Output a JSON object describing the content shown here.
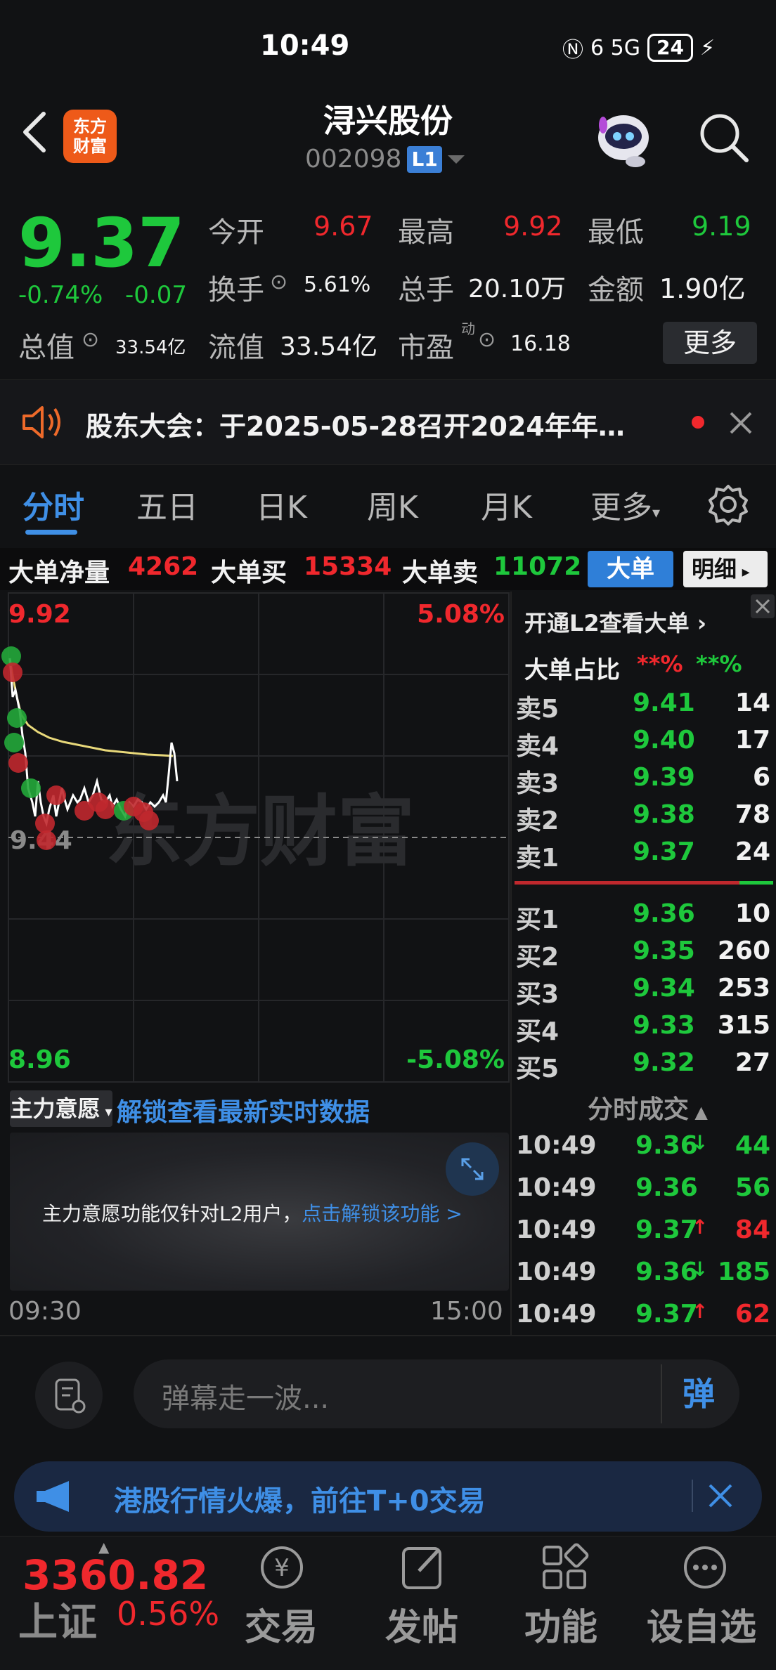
{
  "status_bar": {
    "time": "10:49",
    "signal": "6 5G",
    "battery": "24"
  },
  "header": {
    "stock_name": "浔兴股份",
    "stock_code": "002098",
    "level_badge": "L1",
    "logo_text_1": "东方",
    "logo_text_2": "财富"
  },
  "quote": {
    "price": "9.37",
    "change_pct": "-0.74%",
    "change_val": "-0.07",
    "open_label": "今开",
    "open": "9.67",
    "high_label": "最高",
    "high": "9.92",
    "low_label": "最低",
    "low": "9.19",
    "turnover_label": "换手",
    "turnover": "5.61%",
    "volume_label": "总手",
    "volume": "20.10万",
    "amount_label": "金额",
    "amount": "1.90亿",
    "total_cap_label": "总值",
    "total_cap": "33.54亿",
    "float_cap_label": "流值",
    "float_cap": "33.54亿",
    "pe_label": "市盈",
    "pe_sup": "动",
    "pe": "16.18",
    "more": "更多"
  },
  "notice": {
    "text": "股东大会：于2025-05-28召开2024年年…"
  },
  "tabs": [
    "分时",
    "五日",
    "日K",
    "周K",
    "月K",
    "更多"
  ],
  "big_orders": {
    "net_label": "大单净量",
    "net": "4262",
    "buy_label": "大单买",
    "buy": "15334",
    "sell_label": "大单卖",
    "sell": "11072",
    "btn_big": "大单",
    "btn_detail": "明细"
  },
  "chart": {
    "high_price": "9.92",
    "high_pct": "5.08%",
    "low_price": "8.96",
    "low_pct": "-5.08%",
    "pre_close": "9.44",
    "start_time": "09:30",
    "end_time": "15:00",
    "watermark": "东方财富",
    "colors": {
      "price_line": "#ffffff",
      "avg_line": "#e8d87a",
      "up": "#f0282d",
      "down": "#1ec83c"
    }
  },
  "order_book": {
    "upgrade_text": "开通L2查看大单",
    "ratio_label": "大单占比",
    "ratio_red": "**%",
    "ratio_green": "**%",
    "asks": [
      {
        "label": "卖5",
        "price": "9.41",
        "vol": "14"
      },
      {
        "label": "卖4",
        "price": "9.40",
        "vol": "17"
      },
      {
        "label": "卖3",
        "price": "9.39",
        "vol": "6"
      },
      {
        "label": "卖2",
        "price": "9.38",
        "vol": "78"
      },
      {
        "label": "卖1",
        "price": "9.37",
        "vol": "24"
      }
    ],
    "bids": [
      {
        "label": "买1",
        "price": "9.36",
        "vol": "10"
      },
      {
        "label": "买2",
        "price": "9.35",
        "vol": "260"
      },
      {
        "label": "买3",
        "price": "9.34",
        "vol": "253"
      },
      {
        "label": "买4",
        "price": "9.33",
        "vol": "315"
      },
      {
        "label": "买5",
        "price": "9.32",
        "vol": "27"
      }
    ]
  },
  "main_will": {
    "chip": "主力意愿",
    "unlock": "解锁查看最新实时数据",
    "panel_text": "主力意愿功能仅针对L2用户，",
    "panel_link": "点击解锁该功能 >"
  },
  "trades": {
    "title": "分时成交",
    "rows": [
      {
        "time": "10:49",
        "price": "9.36",
        "arrow": "↓",
        "vol": "44",
        "dir": "down"
      },
      {
        "time": "10:49",
        "price": "9.36",
        "arrow": "",
        "vol": "56",
        "dir": "down"
      },
      {
        "time": "10:49",
        "price": "9.37",
        "arrow": "↑",
        "vol": "84",
        "dir": "up"
      },
      {
        "time": "10:49",
        "price": "9.36",
        "arrow": "↓",
        "vol": "185",
        "dir": "down"
      },
      {
        "time": "10:49",
        "price": "9.37",
        "arrow": "↑",
        "vol": "62",
        "dir": "up"
      }
    ]
  },
  "danmu": {
    "placeholder": "弹幕走一波...",
    "send": "弹"
  },
  "promo": {
    "text": "港股行情火爆，前往T+0交易"
  },
  "bottom_nav": {
    "index_value": "3360.82",
    "index_name": "上证",
    "index_pct": "0.56%",
    "items": [
      "交易",
      "发帖",
      "功能",
      "设自选"
    ]
  }
}
